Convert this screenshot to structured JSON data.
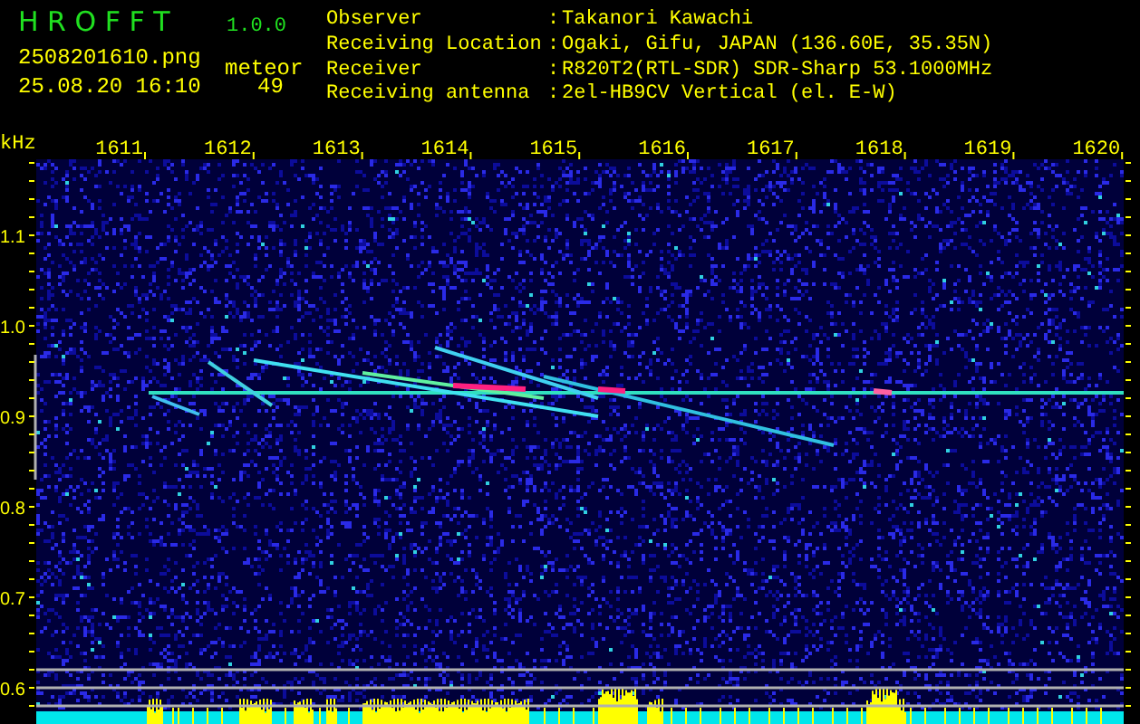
{
  "header": {
    "title": "H R O F F T",
    "version": "1.0.0",
    "filename": "2508201610.png",
    "timestamp": "25.08.20 16:10",
    "meteor_label": "meteor",
    "meteor_count": "49"
  },
  "station_info": [
    {
      "label": "Observer",
      "separator": ":",
      "value": "Takanori Kawachi"
    },
    {
      "label": "Receiving Location",
      "separator": ":",
      "value": "Ogaki, Gifu, JAPAN (136.60E, 35.35N)"
    },
    {
      "label": "Receiver",
      "separator": ":",
      "value": "R820T2(RTL-SDR) SDR-Sharp 53.1000MHz"
    },
    {
      "label": "Receiving antenna",
      "separator": ":",
      "value": "2el-HB9CV Vertical (el. E-W)"
    }
  ],
  "spectrogram": {
    "unit": "kHz",
    "frequency_labels": [
      "1611",
      "1612",
      "1613",
      "1614",
      "1615",
      "1616",
      "1617",
      "1618",
      "1619",
      "1620"
    ],
    "level_labels": [
      "1.1",
      "1.0",
      "0.9",
      "0.8",
      "0.7",
      "0.6"
    ]
  }
}
